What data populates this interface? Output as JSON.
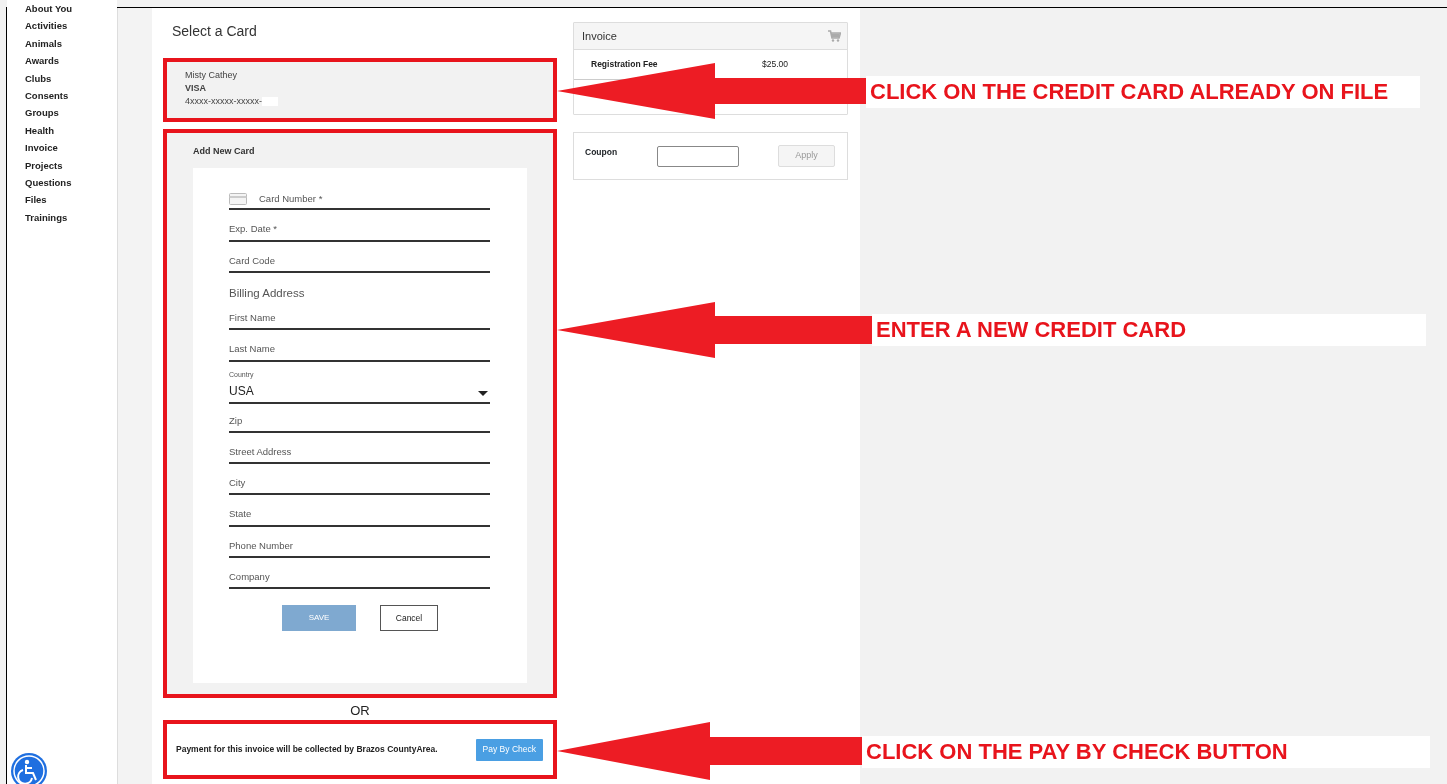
{
  "sidebar": {
    "items": [
      {
        "label": "About You"
      },
      {
        "label": "Activities"
      },
      {
        "label": "Animals"
      },
      {
        "label": "Awards"
      },
      {
        "label": "Clubs"
      },
      {
        "label": "Consents"
      },
      {
        "label": "Groups"
      },
      {
        "label": "Health"
      },
      {
        "label": "Invoice"
      },
      {
        "label": "Projects"
      },
      {
        "label": "Questions"
      },
      {
        "label": "Files"
      },
      {
        "label": "Trainings"
      }
    ]
  },
  "page_title": "Select a Card",
  "saved_card": {
    "name": "Misty Cathey",
    "brand": "VISA",
    "number": "4xxxx-xxxxx-xxxxx-"
  },
  "new_card": {
    "title": "Add New Card",
    "fields": [
      {
        "kind": "card_input",
        "placeholder": "Card Number *"
      },
      {
        "kind": "input",
        "placeholder": "Exp. Date *"
      },
      {
        "kind": "input",
        "placeholder": "Card Code"
      },
      {
        "kind": "heading",
        "text": "Billing Address"
      },
      {
        "kind": "input",
        "placeholder": "First Name"
      },
      {
        "kind": "input",
        "placeholder": "Last Name"
      },
      {
        "kind": "select",
        "label": "Country",
        "value": "USA"
      },
      {
        "kind": "input",
        "placeholder": "Zip"
      },
      {
        "kind": "input",
        "placeholder": "Street Address"
      },
      {
        "kind": "input",
        "placeholder": "City"
      },
      {
        "kind": "input",
        "placeholder": "State"
      },
      {
        "kind": "input",
        "placeholder": "Phone Number"
      },
      {
        "kind": "input",
        "placeholder": "Company"
      }
    ],
    "save": {
      "label": "SAVE",
      "disabled": true
    },
    "cancel": {
      "label": "Cancel"
    }
  },
  "or_text": "OR",
  "check_payment": {
    "message": "Payment for this invoice will be collected by Brazos CountyArea.",
    "button": "Pay By Check"
  },
  "invoice": {
    "title": "Invoice",
    "items": [
      {
        "name": "Registration Fee",
        "amount": "$25.00"
      }
    ]
  },
  "coupon": {
    "label": "Coupon",
    "button": "Apply",
    "button_disabled": true
  },
  "annotations": [
    {
      "text": "CLICK ON THE CREDIT CARD ALREADY ON FILE"
    },
    {
      "text": "ENTER A NEW CREDIT CARD"
    },
    {
      "text": "CLICK ON THE PAY BY CHECK BUTTON"
    }
  ]
}
